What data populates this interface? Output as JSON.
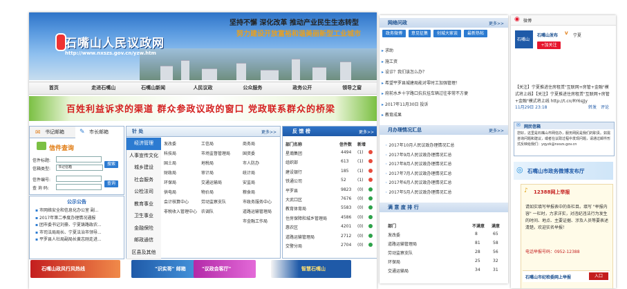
{
  "site": {
    "title": "石嘴山人民议政网",
    "url": "http://www.nxszs.gov.cn/yzw.htm",
    "slogan1": "坚持不懈  深化改革  推动产业民生生态转型",
    "slogan2": "努力建设开放富裕和谐美丽新型工业城市"
  },
  "nav": [
    "首页",
    "走进石嘴山",
    "石嘴山新闻",
    "人民议政",
    "公众服务",
    "政务公开",
    "领导之窗"
  ],
  "ribbon": "百姓利益诉求的渠道   群众参政议政的窗口   党政联系群众的桥梁",
  "mailbox": {
    "tab_secretary": "书记邮箱",
    "tab_mayor": "市长邮箱",
    "query_title": "信件查询",
    "label_title": "信件标题:",
    "label_type": "信箱类型:",
    "type_value": "书记信箱",
    "label_no": "信件编号:",
    "label_pwd": "查 询 码:",
    "btn_search": "搜索",
    "btn_query": "查询"
  },
  "notice": {
    "title": "公示公告",
    "items": [
      "市网络安全和信息化办公室 副...",
      "2017年第二季度办理情况通报",
      "团市委书记刘豪、宁夏铸路政农...",
      "市司法局局长、宁夏法治市领导...",
      "平罗县人社局副局长黄志刚走进..."
    ]
  },
  "depts": {
    "title": "针  处",
    "more": "更多>>",
    "categories": [
      "经济管理",
      "人事宣传文化",
      "城乡建设",
      "社会服务",
      "公检法司",
      "教育事业",
      "卫生事业",
      "金融保险",
      "邮政通信",
      "区县及其他"
    ],
    "columns": [
      [
        "发改委",
        "科技局",
        "国土局",
        "财政局",
        "环保局",
        "供电局",
        "会计核算中心",
        "非税收入管理中心"
      ],
      [
        "工信局",
        "市场监督管理局",
        "地税局",
        "审计局",
        "交通运输局",
        "物价局",
        "劳动监察支队",
        "农调队"
      ],
      [
        "商务局",
        "国资委",
        "市人防办",
        "统计局",
        "安监局",
        "粮食局",
        "市政务服务中心",
        "道路运输管理局",
        "市金融工作局"
      ]
    ]
  },
  "feedback": {
    "title": "反 馈 榜",
    "more": "更多>>",
    "headers": [
      "部门名称",
      "信件数",
      "新增"
    ],
    "rows": [
      {
        "name": "星瀚集团",
        "count": "4494",
        "new": "(1)"
      },
      {
        "name": "组织部",
        "count": "613",
        "new": "(1)"
      },
      {
        "name": "建设银行",
        "count": "185",
        "new": "(1)"
      },
      {
        "name": "铁通公司",
        "count": "52",
        "new": "(1)"
      },
      {
        "name": "平罗县",
        "count": "9823",
        "new": "(0)"
      },
      {
        "name": "大武口区",
        "count": "7676",
        "new": "(0)"
      },
      {
        "name": "教育体育局",
        "count": "5583",
        "new": "(0)"
      },
      {
        "name": "住房保障和城乡管理局",
        "count": "4586",
        "new": "(0)"
      },
      {
        "name": "惠农区",
        "count": "4201",
        "new": "(0)"
      },
      {
        "name": "道路运输管理局",
        "count": "2712",
        "new": "(0)"
      },
      {
        "name": "交警分局",
        "count": "2704",
        "new": "(0)"
      }
    ]
  },
  "ads": [
    "石嘴山政风行风热线",
    "\"识实哥\" 邮箱",
    "\"议政会客厅\"",
    "智慧石嘴山"
  ],
  "qa": {
    "title": "网络问政",
    "more": "更多>>",
    "tabs": [
      "政务微博",
      "意见征集",
      "创城大家谈",
      "最新热帖"
    ],
    "items": [
      "求助",
      "施工资",
      "设诊？我们该怎么办？",
      "希望平罗县城建局能对零时工加强管理！",
      "府前水乡十字路口抗抗挂车辆过往非常不方便",
      "2017年11月30日 投诉",
      "教育成果"
    ]
  },
  "monthly": {
    "title": "月办理情况汇总",
    "more": "更多>>",
    "items": [
      "2017年10月人民议政办理情况汇总",
      "2017年9月人民议政办理情况汇总",
      "2017年8月人民议政办理情况汇总",
      "2017年7月人民议政办理情况汇总",
      "2017年6月人民议政办理情况汇总",
      "2017年5月人民议政办理情况汇总"
    ]
  },
  "satisfaction": {
    "title": "满 意 度 排 行",
    "headers": [
      "部门",
      "不满意",
      "满意"
    ],
    "rows": [
      {
        "name": "发改委",
        "bad": "8",
        "good": "65"
      },
      {
        "name": "道路运输管理局",
        "bad": "81",
        "good": "58"
      },
      {
        "name": "劳动监察支队",
        "bad": "28",
        "good": "56"
      },
      {
        "name": "环保局",
        "bad": "25",
        "good": "32"
      },
      {
        "name": "交通运输局",
        "bad": "34",
        "good": "31"
      }
    ]
  },
  "weibo": {
    "brand": "微博",
    "account": "石嘴山发布",
    "verified": "V",
    "location": "宁夏",
    "follow": "+加关注",
    "post": "【关注】宁夏推进住房租赁\"互联网+房管+金融\"模式将上线】【关注】宁夏推进住房租赁\"互联网+房管+金融\"模式将上线 http://t.cn/RY6sJJy",
    "time": "11月29日 23:18",
    "repost": "转发",
    "comment": "评论"
  },
  "netinfo": {
    "title": "网民信箱",
    "text": "您好，这里是石嘴山市网信办，服务网民是我们的职责。如需咨询问题和建议，或者在议政过程中发现问题，请通过邮件形式反映给我们：yqyzk@nxszs.gov.cn"
  },
  "microhall": "石嘴山市政务微博发布厅",
  "report": {
    "title": "12388网上举报",
    "text": "请如实填写举报表中的各栏目。填写 \"举报内容\" 一栏时，力求详实，对违纪违法行为发生的时间、地点、主要证据、涉及人员等要表述清楚。欢迎实名举报！",
    "phone": "电话举报号码：0952-12388",
    "footer": "石嘴山市纪检委网上举报",
    "entry": "入口"
  },
  "colors": {
    "primary": "#2c7bd1",
    "accent": "#d42020",
    "orange": "#e07a10"
  }
}
